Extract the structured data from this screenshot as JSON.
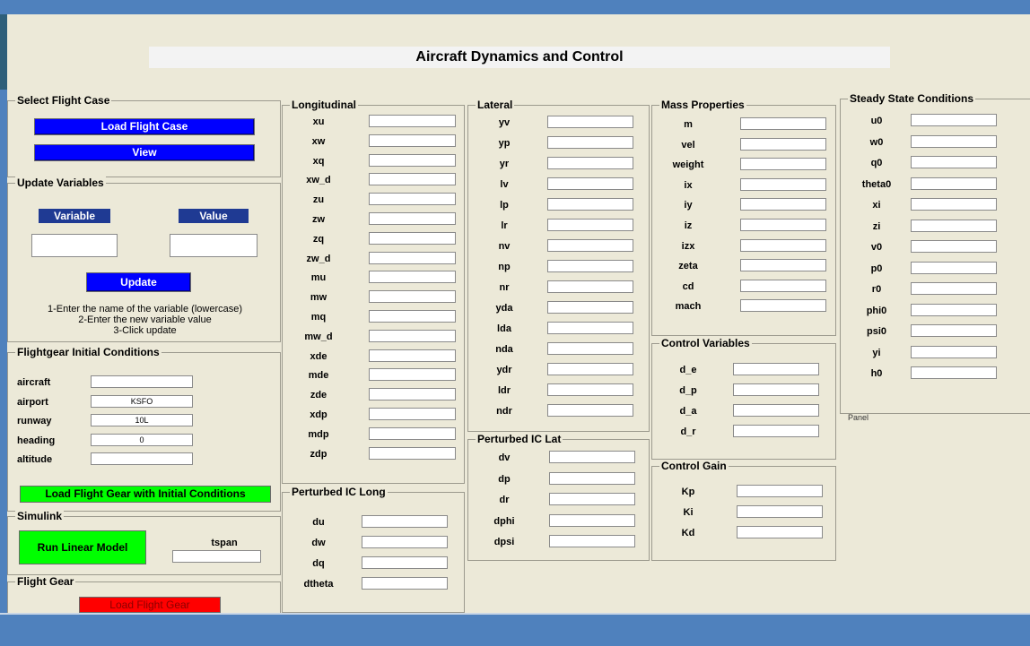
{
  "title": "Aircraft Dynamics and Control",
  "select_case": {
    "title": "Select Flight Case",
    "load_label": "Load Flight Case",
    "view_label": "View"
  },
  "update_vars": {
    "title": "Update Variables",
    "variable_label": "Variable",
    "value_label": "Value",
    "update_label": "Update",
    "instructions": [
      "1-Enter the name of the variable (lowercase)",
      "2-Enter the new variable value",
      "3-Click update"
    ]
  },
  "fg_init": {
    "title": "Flightgear Initial Conditions",
    "fields": [
      {
        "label": "aircraft",
        "value": ""
      },
      {
        "label": "airport",
        "value": "KSFO"
      },
      {
        "label": "runway",
        "value": "10L"
      },
      {
        "label": "heading",
        "value": "0"
      },
      {
        "label": "altitude",
        "value": ""
      }
    ],
    "button_label": "Load Flight Gear with Initial Conditions"
  },
  "simulink": {
    "title": "Simulink",
    "run_label": "Run Linear Model",
    "tspan_label": "tspan"
  },
  "flight_gear": {
    "title": "Flight Gear",
    "load_label": "Load Flight Gear"
  },
  "longitudinal": {
    "title": "Longitudinal",
    "vars": [
      "xu",
      "xw",
      "xq",
      "xw_d",
      "zu",
      "zw",
      "zq",
      "zw_d",
      "mu",
      "mw",
      "mq",
      "mw_d",
      "xde",
      "mde",
      "zde",
      "xdp",
      "mdp",
      "zdp"
    ]
  },
  "perturbed_long": {
    "title": "Perturbed IC Long",
    "vars": [
      "du",
      "dw",
      "dq",
      "dtheta"
    ]
  },
  "lateral": {
    "title": "Lateral",
    "vars": [
      "yv",
      "yp",
      "yr",
      "lv",
      "lp",
      "lr",
      "nv",
      "np",
      "nr",
      "yda",
      "lda",
      "nda",
      "ydr",
      "ldr",
      "ndr"
    ]
  },
  "perturbed_lat": {
    "title": "Perturbed IC Lat",
    "vars": [
      "dv",
      "dp",
      "dr",
      "dphi",
      "dpsi"
    ]
  },
  "mass": {
    "title": "Mass Properties",
    "vars": [
      "m",
      "vel",
      "weight",
      "ix",
      "iy",
      "iz",
      "izx",
      "zeta",
      "cd",
      "mach"
    ]
  },
  "control_vars": {
    "title": "Control Variables",
    "vars": [
      "d_e",
      "d_p",
      "d_a",
      "d_r"
    ]
  },
  "control_gain": {
    "title": "Control Gain",
    "vars": [
      "Kp",
      "Ki",
      "Kd"
    ]
  },
  "steady": {
    "title": "Steady State Conditions",
    "vars": [
      "u0",
      "w0",
      "q0",
      "theta0",
      "xi",
      "zi",
      "v0",
      "p0",
      "r0",
      "phi0",
      "psi0",
      "yi",
      "h0"
    ],
    "footer": "Panel"
  },
  "colors": {
    "button_blue": "#0000ff",
    "header_blue": "#1f3a93",
    "green": "#00ff00",
    "red": "#ff0000",
    "background": "#ece9d8",
    "frame": "#4f81bd"
  }
}
